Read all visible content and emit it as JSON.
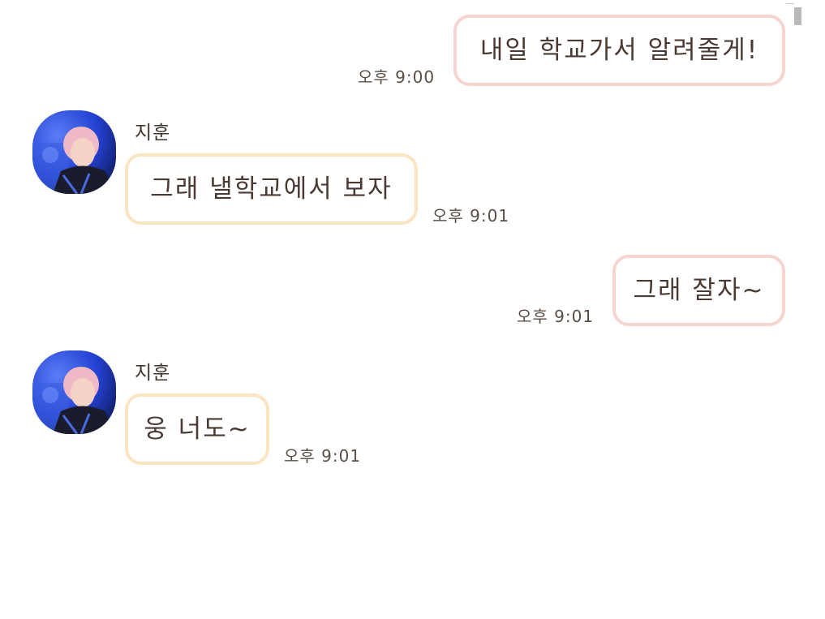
{
  "messages": [
    {
      "from": "me",
      "text": "내일 학교가서 알려줄게!",
      "time": "오후 9:00"
    },
    {
      "from": "them",
      "sender": "지훈",
      "text": "그래 낼학교에서 보자",
      "time": "오후 9:01"
    },
    {
      "from": "me",
      "text": "그래 잘자~",
      "time": "오후 9:01"
    },
    {
      "from": "them",
      "sender": "지훈",
      "text": "웅 너도~",
      "time": "오후 9:01"
    }
  ],
  "colors": {
    "me_bubble_border": "#f6d4d0",
    "them_bubble_border": "#fbe4c2",
    "text": "#4b3a33",
    "avatar_bg": "#2a4fd8"
  },
  "icons": {
    "avatar": "profile-photo"
  }
}
